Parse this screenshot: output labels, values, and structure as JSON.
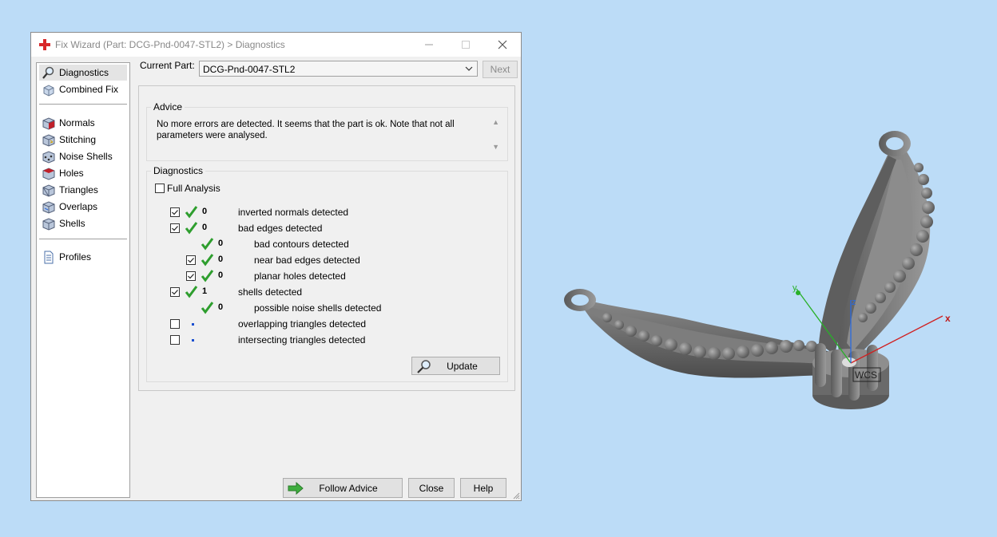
{
  "window": {
    "title": "Fix Wizard (Part: DCG-Pnd-0047-STL2) > Diagnostics"
  },
  "sidebar": {
    "items": [
      {
        "label": "Diagnostics",
        "icon": "magnifier-icon"
      },
      {
        "label": "Combined Fix",
        "icon": "cubes-icon"
      },
      {
        "label": "Normals",
        "icon": "normals-cube-icon"
      },
      {
        "label": "Stitching",
        "icon": "stitching-cube-icon"
      },
      {
        "label": "Noise Shells",
        "icon": "noise-shells-cube-icon"
      },
      {
        "label": "Holes",
        "icon": "holes-cube-icon"
      },
      {
        "label": "Triangles",
        "icon": "triangles-cube-icon"
      },
      {
        "label": "Overlaps",
        "icon": "overlaps-cube-icon"
      },
      {
        "label": "Shells",
        "icon": "shells-cube-icon"
      },
      {
        "label": "Profiles",
        "icon": "document-icon"
      }
    ]
  },
  "current_part": {
    "label": "Current Part:",
    "value": "DCG-Pnd-0047-STL2",
    "next_label": "Next"
  },
  "advice": {
    "title": "Advice",
    "text": "No more errors are detected. It seems that the part is ok. Note that not all parameters were analysed."
  },
  "diagnostics": {
    "title": "Diagnostics",
    "full_analysis_label": "Full Analysis",
    "rows": [
      {
        "checked": true,
        "status": "ok",
        "count": "0",
        "label": "inverted normals detected"
      },
      {
        "checked": true,
        "status": "ok",
        "count": "0",
        "label": "bad edges detected"
      },
      {
        "checked": null,
        "status": "ok",
        "count": "0",
        "label": "bad contours detected"
      },
      {
        "checked": true,
        "status": "ok",
        "count": "0",
        "label": "near bad edges detected"
      },
      {
        "checked": true,
        "status": "ok",
        "count": "0",
        "label": "planar holes detected"
      },
      {
        "checked": true,
        "status": "ok",
        "count": "1",
        "label": "shells detected"
      },
      {
        "checked": null,
        "status": "ok",
        "count": "0",
        "label": "possible noise shells detected"
      },
      {
        "checked": false,
        "status": "pending",
        "count": "",
        "label": "overlapping triangles detected"
      },
      {
        "checked": false,
        "status": "pending",
        "count": "",
        "label": "intersecting triangles detected"
      }
    ],
    "update_label": "Update"
  },
  "footer": {
    "follow_advice_label": "Follow Advice",
    "close_label": "Close",
    "help_label": "Help"
  },
  "viewport": {
    "axis_x": "x",
    "axis_y": "y",
    "axis_z": "z",
    "wcs_label": "WCS",
    "background": "#bcdcf7",
    "model_color": "#6e6e6e"
  },
  "colors": {
    "check_green": "#2e9e2e",
    "title_red": "#d8282a"
  }
}
